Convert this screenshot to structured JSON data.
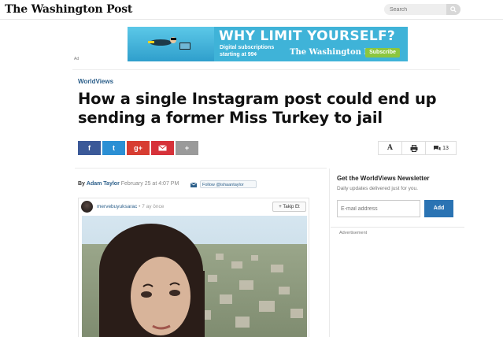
{
  "header": {
    "logo": "The Washington Post",
    "search_placeholder": "Search"
  },
  "ad": {
    "headline": "WHY LIMIT YOURSELF?",
    "line1": "Digital subscriptions",
    "line2": "starting at 99¢",
    "brand": "The Washington Post",
    "button": "Subscribe",
    "label": "Ad"
  },
  "article": {
    "kicker": "WorldViews",
    "title": "How a single Instagram post could end up sending a former Miss Turkey to jail",
    "byline_prefix": "By",
    "author": "Adam Taylor",
    "date": "February 25 at 4:07 PM",
    "follow": "Follow @ishaantaylor"
  },
  "share": {
    "facebook_icon": "f",
    "twitter_icon": "t",
    "googleplus_icon": "g+",
    "more_icon": "+",
    "font_icon": "A",
    "comment_count": "13"
  },
  "instagram": {
    "username": "mervebuyuksarac",
    "ago": "• 7 ay önce",
    "follow_button": "+ Takip Et"
  },
  "sidebar": {
    "newsletter_title": "Get the WorldViews Newsletter",
    "newsletter_desc": "Daily updates delivered just for you.",
    "email_placeholder": "E-mail address",
    "add_button": "Add",
    "advertisement": "Advertisement"
  },
  "colors": {
    "facebook": "#3b5998",
    "twitter": "#2b8fd4",
    "googleplus": "#d73d32",
    "mail": "#d6323a",
    "more": "#9a9a9a",
    "accent": "#2a73b3"
  }
}
